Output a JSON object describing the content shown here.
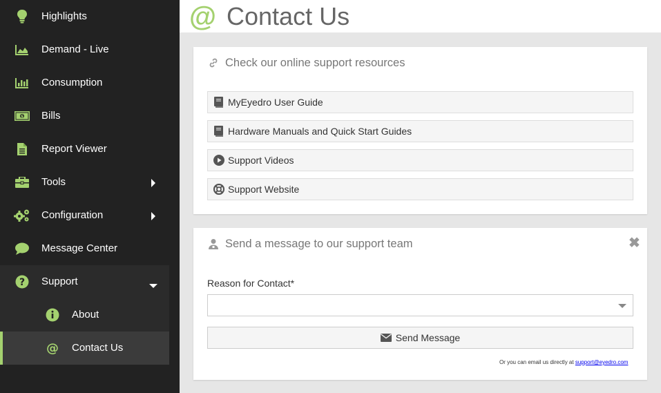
{
  "sidebar": {
    "items": [
      {
        "label": "Highlights",
        "icon": "lightbulb-icon"
      },
      {
        "label": "Demand - Live",
        "icon": "area-chart-icon"
      },
      {
        "label": "Consumption",
        "icon": "bar-chart-icon"
      },
      {
        "label": "Bills",
        "icon": "money-icon"
      },
      {
        "label": "Report Viewer",
        "icon": "file-text-icon"
      },
      {
        "label": "Tools",
        "icon": "briefcase-icon"
      },
      {
        "label": "Configuration",
        "icon": "gears-icon"
      },
      {
        "label": "Message Center",
        "icon": "comment-icon"
      },
      {
        "label": "Support",
        "icon": "question-circle-icon"
      }
    ],
    "support_sub": [
      {
        "label": "About",
        "icon": "info-circle-icon"
      },
      {
        "label": "Contact Us",
        "icon": "at-icon"
      }
    ],
    "accent_color": "#a4d16f",
    "background_color": "#222222"
  },
  "header": {
    "icon_text": "@",
    "title": "Contact Us"
  },
  "resources": {
    "heading": "Check our online support resources",
    "links": [
      {
        "label": "MyEyedro User Guide",
        "icon": "book-icon"
      },
      {
        "label": "Hardware Manuals and Quick Start Guides",
        "icon": "book-icon"
      },
      {
        "label": "Support Videos",
        "icon": "play-circle-icon"
      },
      {
        "label": "Support Website",
        "icon": "life-ring-icon"
      }
    ]
  },
  "message": {
    "heading": "Send a message to our support team",
    "close_symbol": "✖",
    "reason_label": "Reason for Contact*",
    "reason_value": "",
    "send_label": "Send Message",
    "email_note_prefix": "Or you can email us directly at ",
    "email": "support@eyedro.com"
  }
}
